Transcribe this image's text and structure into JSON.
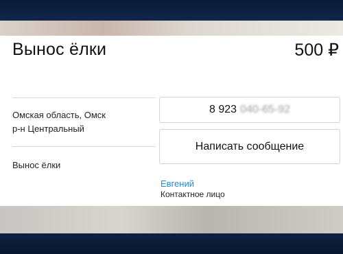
{
  "listing": {
    "title": "Вынос ёлки",
    "price": "500 ₽"
  },
  "location": {
    "line1": "Омская область, Омск",
    "line2": "р-н Центральный"
  },
  "category": "Вынос ёлки",
  "phone": {
    "visible_part": "8 923",
    "hidden_part": "040-65-92"
  },
  "actions": {
    "message_label": "Написать сообщение"
  },
  "contact": {
    "name": "Евгений",
    "role": "Контактное лицо"
  },
  "colors": {
    "accent_link": "#1a8fd6",
    "frame_dark": "#0c1d38"
  }
}
